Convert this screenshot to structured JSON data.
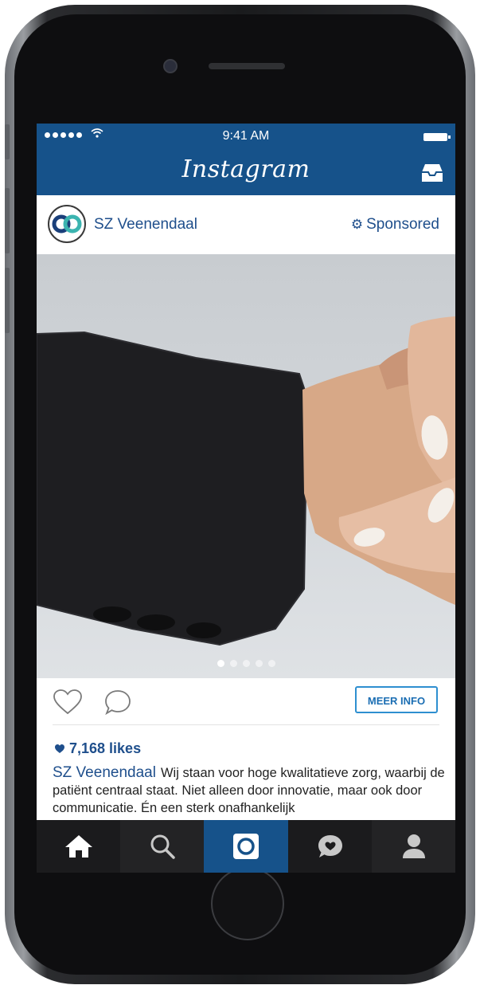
{
  "status_bar": {
    "time": "9:41 AM"
  },
  "nav": {
    "title": "Instagram"
  },
  "post": {
    "username": "SZ Veenendaal",
    "sponsored_label": "Sponsored",
    "carousel": {
      "total": 5,
      "active": 1
    },
    "cta_label": "MEER INFO",
    "likes": "7,168 likes",
    "caption_user": "SZ Veenendaal",
    "caption_text": "Wij staan voor hoge kwalitatieve zorg, waarbij de patiënt centraal staat. Niet alleen door innovatie, maar ook door communicatie. Én een sterk onafhankelijk"
  },
  "tab_bar": {
    "items": [
      "home-icon",
      "search-icon",
      "camera-icon",
      "activity-icon",
      "profile-icon"
    ],
    "active": 2
  },
  "colors": {
    "brand_blue": "#16528a",
    "link_blue": "#1f4f8c",
    "cta_border": "#2e8fd0"
  }
}
